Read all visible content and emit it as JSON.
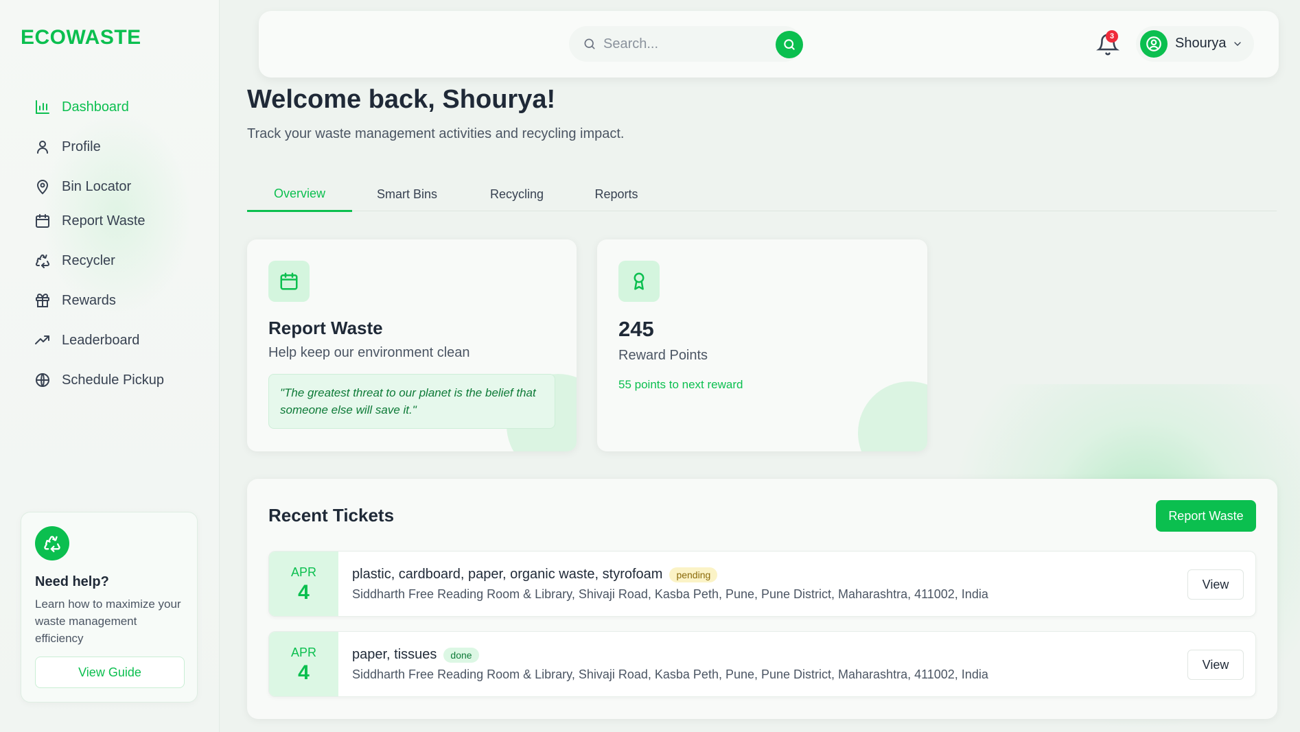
{
  "app": {
    "logo": "ECOWASTE"
  },
  "sidebar": {
    "items": [
      {
        "label": "Dashboard",
        "icon": "bar-chart-icon",
        "active": true
      },
      {
        "label": "Profile",
        "icon": "user-icon"
      },
      {
        "label": "Bin Locator",
        "icon": "map-pin-icon"
      },
      {
        "label": "Report Waste",
        "icon": "calendar-icon"
      },
      {
        "label": "Recycler",
        "icon": "recycle-icon"
      },
      {
        "label": "Rewards",
        "icon": "gift-icon"
      },
      {
        "label": "Leaderboard",
        "icon": "trending-up-icon"
      },
      {
        "label": "Schedule Pickup",
        "icon": "globe-icon"
      }
    ],
    "help": {
      "title": "Need help?",
      "text": "Learn how to maximize your waste management efficiency",
      "button": "View Guide"
    }
  },
  "topbar": {
    "search_placeholder": "Search...",
    "notifications_count": "3",
    "user_name": "Shourya"
  },
  "header": {
    "title": "Welcome back, Shourya!",
    "subtitle": "Track your waste management activities and recycling impact."
  },
  "tabs": [
    {
      "label": "Overview",
      "active": true
    },
    {
      "label": "Smart Bins"
    },
    {
      "label": "Recycling"
    },
    {
      "label": "Reports"
    }
  ],
  "cards": {
    "report": {
      "title": "Report Waste",
      "subtitle": "Help keep our environment clean",
      "quote": "\"The greatest threat to our planet is the belief that someone else will save it.\""
    },
    "points": {
      "value": "245",
      "label": "Reward Points",
      "next": "55 points to next reward"
    }
  },
  "tickets": {
    "title": "Recent Tickets",
    "report_button": "Report Waste",
    "items": [
      {
        "month": "APR",
        "day": "4",
        "title": "plastic, cardboard, paper, organic waste, styrofoam",
        "status": "pending",
        "address": "Siddharth Free Reading Room & Library, Shivaji Road, Kasba Peth, Pune, Pune District, Maharashtra, 411002, India",
        "action": "View"
      },
      {
        "month": "APR",
        "day": "4",
        "title": "paper, tissues",
        "status": "done",
        "address": "Siddharth Free Reading Room & Library, Shivaji Road, Kasba Peth, Pune, Pune District, Maharashtra, 411002, India",
        "action": "View"
      }
    ]
  },
  "colors": {
    "accent": "#0bbf4f",
    "badge_red": "#ef2b3a",
    "pending_bg": "#fbf3c6",
    "done_bg": "#dcf7e4"
  }
}
